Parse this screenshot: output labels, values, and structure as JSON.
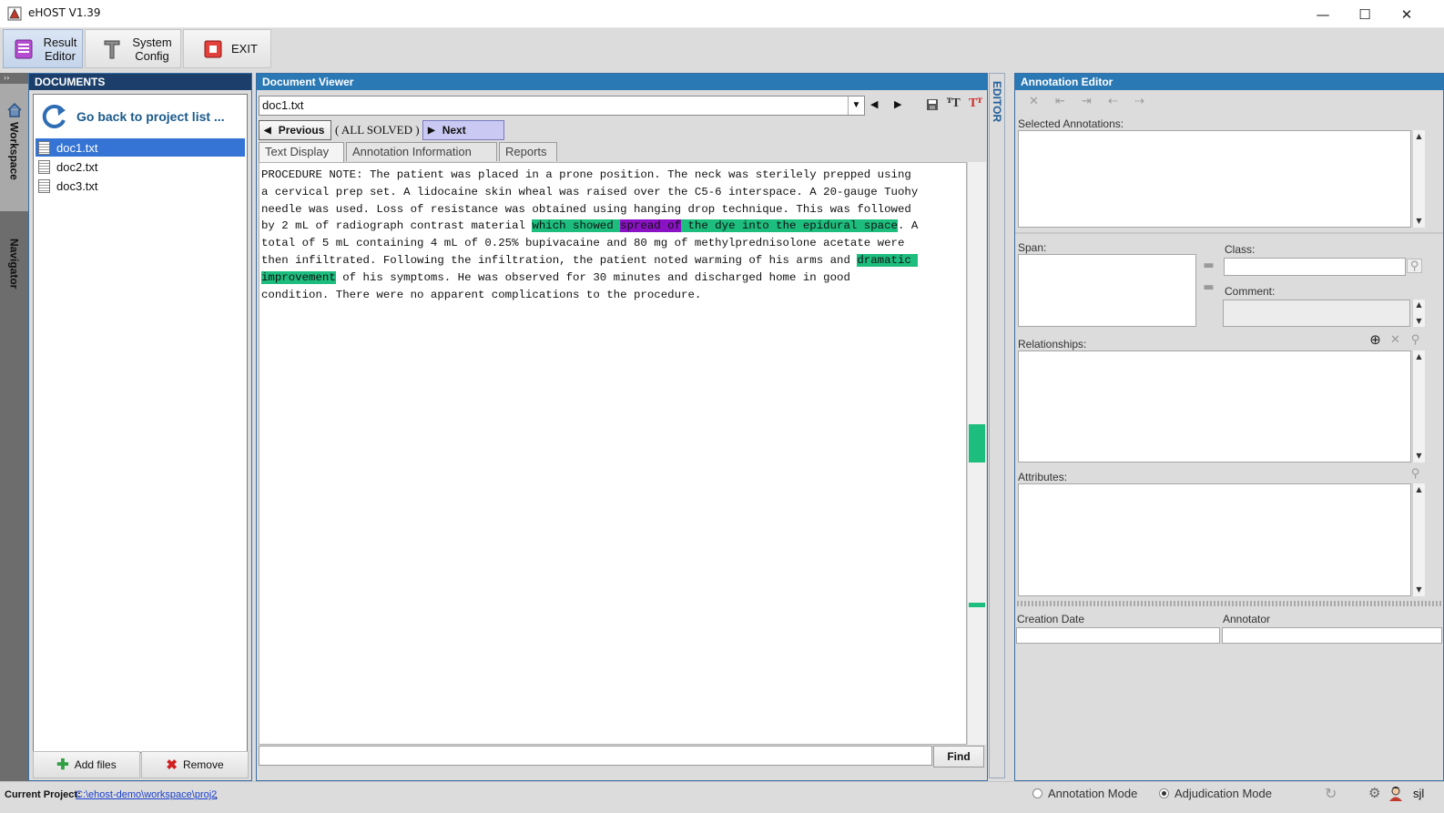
{
  "window": {
    "title": "eHOST V1.39",
    "minimize": "—",
    "maximize": "☐",
    "close": "✕"
  },
  "toolbar": {
    "result_editor": "Result Editor",
    "system_config": "System Config",
    "exit": "EXIT"
  },
  "side_tabs": {
    "workspace": "Workspace",
    "navigator": "Navigator"
  },
  "documents": {
    "header": "DOCUMENTS",
    "back_link": "Go back to project list ...",
    "files": [
      "doc1.txt",
      "doc2.txt",
      "doc3.txt"
    ],
    "selected_index": 0,
    "add_files": "Add files",
    "remove": "Remove"
  },
  "viewer": {
    "header": "Document Viewer",
    "current_file": "doc1.txt",
    "previous": "Previous",
    "all_solved": "( ALL SOLVED )",
    "next": "Next",
    "tabs": [
      "Text Display",
      "Annotation Information",
      "Reports"
    ],
    "active_tab": 0,
    "text": {
      "lines": [
        "PROCEDURE NOTE: The patient was placed in a prone position. The neck was sterilely prepped using",
        "a cervical prep set. A lidocaine skin wheal was raised over the C5-6 interspace. A 20-gauge Tuohy",
        "needle was used. Loss of resistance was obtained using hanging drop technique. This was followed"
      ],
      "line4_pre": "by 2 mL of radiograph contrast material ",
      "hl1_a": "which showed ",
      "hl1_b": "spread of",
      "hl1_c": " the dye into the epidural space",
      "line4_post": ". A",
      "line5": "total of 5 mL containing 4 mL of 0.25% bupivacaine and 80 mg of methylprednisolone acetate were",
      "line6_pre": "then infiltrated. Following the infiltration, the patient noted warming of his arms and ",
      "hl2_a": "dramatic ",
      "hl2_b": "improvement",
      "line7_post": " of his symptoms. He was observed for 30 minutes and discharged home in good",
      "line8": "condition. There were no apparent complications to the procedure."
    },
    "find": "Find",
    "highlight_colors": {
      "green": "#1dbd7e",
      "purple": "#8a12c4"
    }
  },
  "editor_tab": "EDITOR",
  "annotation_editor": {
    "header": "Annotation Editor",
    "selected_annotations": "Selected Annotations:",
    "span": "Span:",
    "class": "Class:",
    "comment": "Comment:",
    "relationships": "Relationships:",
    "attributes": "Attributes:",
    "creation_date": "Creation Date",
    "annotator": "Annotator"
  },
  "statusbar": {
    "current_project_label": "Current Project:",
    "current_project_path": "C:\\ehost-demo\\workspace\\proj2",
    "annotation_mode": "Annotation Mode",
    "adjudication_mode": "Adjudication Mode",
    "mode_selected": "adjudication",
    "user": "sjl"
  }
}
